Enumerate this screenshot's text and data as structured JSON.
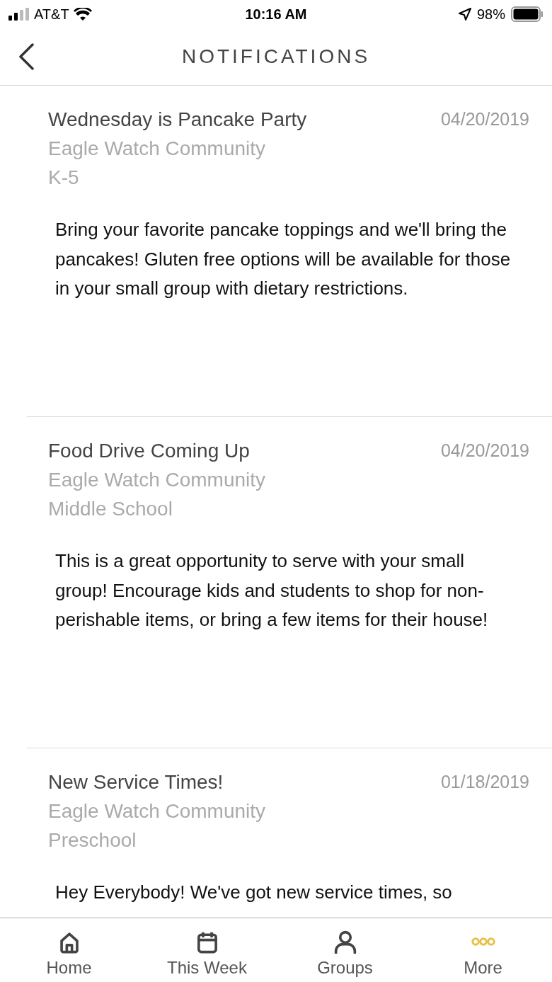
{
  "status_bar": {
    "carrier": "AT&T",
    "time": "10:16 AM",
    "battery": "98%"
  },
  "header": {
    "title": "NOTIFICATIONS"
  },
  "notifications": [
    {
      "title": "Wednesday is Pancake Party",
      "date": "04/20/2019",
      "community": "Eagle Watch Community",
      "group": "K-5",
      "body": "Bring your favorite pancake toppings and we'll bring the pancakes! Gluten free options will be available for those in your small group with dietary restrictions."
    },
    {
      "title": "Food Drive Coming Up",
      "date": "04/20/2019",
      "community": "Eagle Watch Community",
      "group": "Middle School",
      "body": "This is a great opportunity to serve with your small group! Encourage kids and students to shop for non-perishable items, or bring a few items for their house!"
    },
    {
      "title": "New Service Times!",
      "date": "01/18/2019",
      "community": "Eagle Watch Community",
      "group": "Preschool",
      "body": "Hey Everybody! We've got new service times, so"
    }
  ],
  "tab_bar": [
    {
      "label": "Home",
      "kind": "home",
      "selected": false
    },
    {
      "label": "This Week",
      "kind": "calendar",
      "selected": false
    },
    {
      "label": "Groups",
      "kind": "person",
      "selected": false
    },
    {
      "label": "More",
      "kind": "more",
      "selected": true
    }
  ]
}
